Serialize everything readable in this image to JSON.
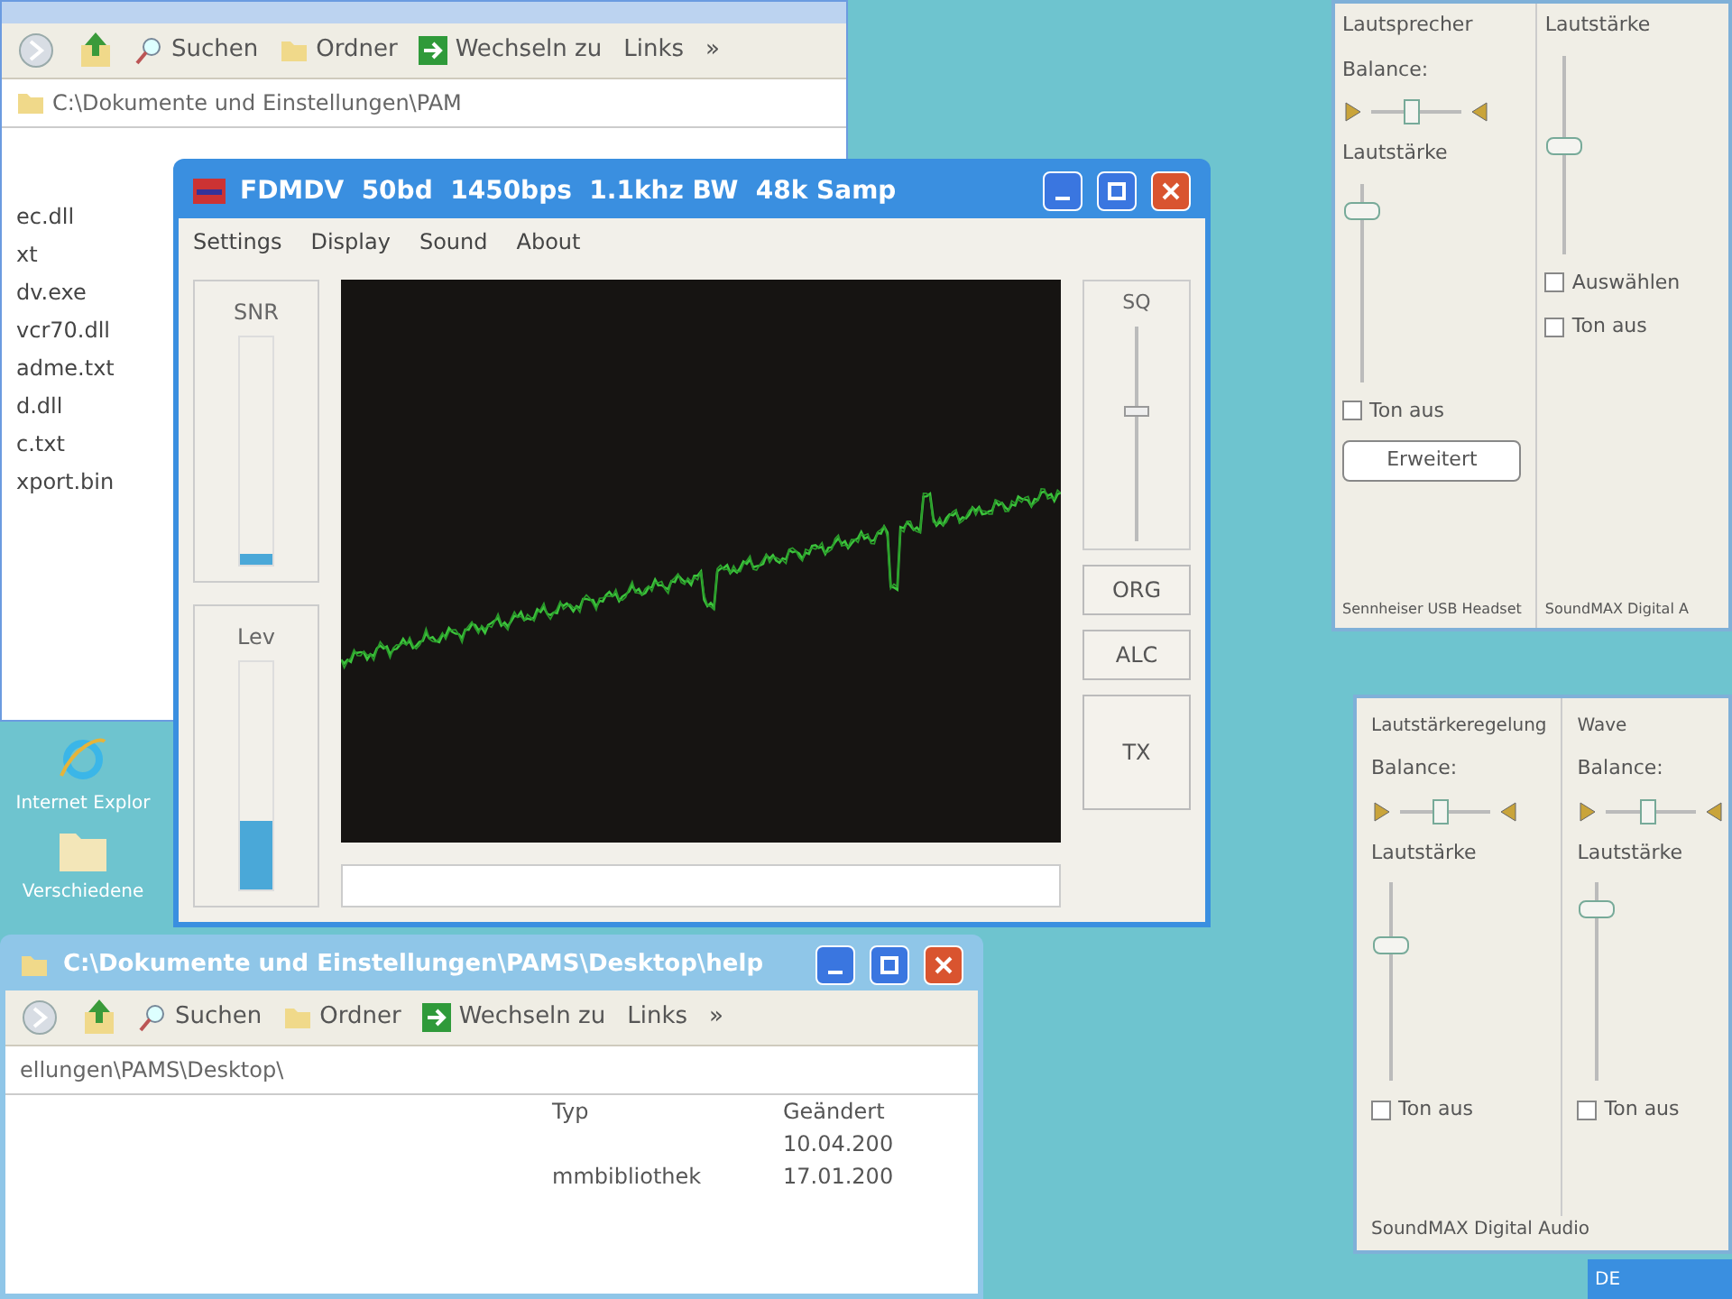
{
  "explorer_top": {
    "toolbar": [
      "Suchen",
      "Ordner",
      "Wechseln zu",
      "Links",
      "»"
    ],
    "address": "C:\\Dokumente und Einstellungen\\PAM",
    "files": [
      "ec.dll",
      "xt",
      "dv.exe",
      "vcr70.dll",
      "adme.txt",
      "d.dll",
      "c.txt",
      "xport.bin"
    ]
  },
  "desktop_icons": [
    {
      "label": "Internet Explor",
      "kind": "browser"
    },
    {
      "label": "Verschiedene",
      "kind": "folder"
    }
  ],
  "fdmdv": {
    "title": "FDMDV  50bd  1450bps  1.1khz BW  48k Samp",
    "menu": [
      "Settings",
      "Display",
      "Sound",
      "About"
    ],
    "snr": {
      "label": "SNR",
      "level": 0.05
    },
    "lev": {
      "label": "Lev",
      "level": 0.3
    },
    "sq": {
      "label": "SQ",
      "level": 0.6
    },
    "buttons": [
      "ORG",
      "ALC"
    ],
    "tx": "TX"
  },
  "mixer_top": {
    "columns": [
      {
        "title": "Lautsprecher",
        "balance": {
          "label": "Balance:",
          "level": 0.45
        },
        "volume_label": "Lautstärke",
        "level": 0.9,
        "mute": {
          "label": "Ton aus",
          "checked": false
        },
        "button": "Erweitert",
        "device": "Sennheiser USB Headset"
      },
      {
        "title": "Lautstärke",
        "level": 0.55,
        "mute": {
          "label": "Auswählen",
          "checked": false
        },
        "device": "SoundMAX Digital A"
      }
    ],
    "extra_mute": {
      "label": "Ton aus",
      "checked": false
    }
  },
  "mixer_bottom": {
    "columns": [
      {
        "title": "Lautstärkeregelung",
        "balance": {
          "label": "Balance:",
          "level": 0.45
        },
        "volume_label": "Lautstärke",
        "level": 0.7,
        "mute": {
          "label": "Ton aus",
          "checked": false
        }
      },
      {
        "title": "Wave",
        "balance": {
          "label": "Balance:",
          "level": 0.45
        },
        "volume_label": "Lautstärke",
        "level": 0.9,
        "mute": {
          "label": "Ton aus",
          "checked": false
        }
      }
    ],
    "device": "SoundMAX Digital Audio"
  },
  "explorer_bottom": {
    "title": "C:\\Dokumente und Einstellungen\\PAMS\\Desktop\\help",
    "toolbar": [
      "Suchen",
      "Ordner",
      "Wechseln zu",
      "Links",
      "»"
    ],
    "address": "ellungen\\PAMS\\Desktop\\",
    "columns": [
      "Typ",
      "Geändert"
    ],
    "rows": [
      [
        "",
        "10.04.200"
      ],
      [
        "mmbibliothek",
        "17.01.200"
      ]
    ]
  },
  "taskbar": {
    "language": "DE"
  }
}
